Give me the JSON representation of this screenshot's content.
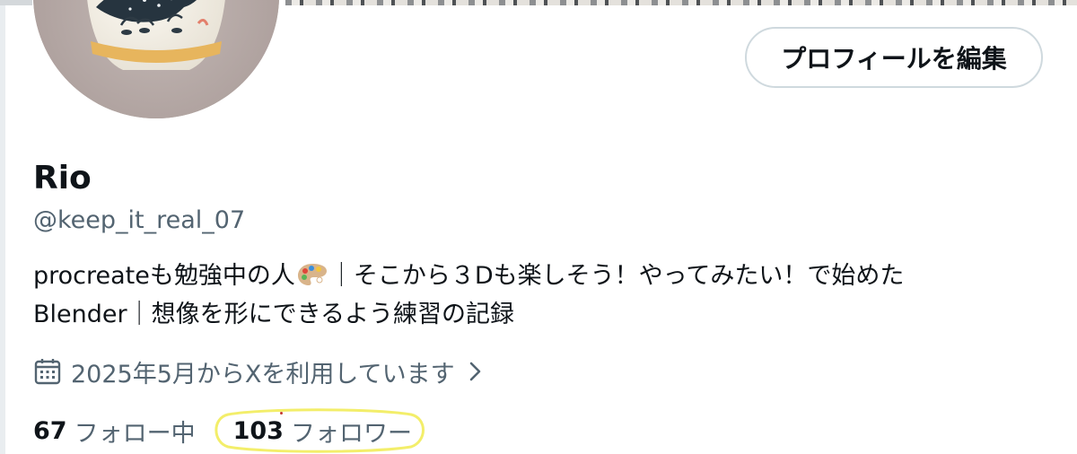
{
  "profile": {
    "edit_button_label": "プロフィールを編集",
    "display_name": "Rio",
    "handle": "@keep_it_real_07",
    "bio": {
      "line1_before": "procreateも勉強中の人",
      "line1_after": "｜そこから３Dも楽しそう！やってみたい！で始めた",
      "line2": "Blender｜想像を形にできるよう練習の記録"
    },
    "joined_text": "2025年5月からXを利用しています",
    "following_count": "67",
    "following_label": "フォロー中",
    "followers_count": "103",
    "followers_label": "フォロワー"
  },
  "icons": {
    "bio_emoji": "artist-palette-icon",
    "joined": "calendar-icon",
    "joined_more": "chevron-right-icon"
  },
  "colors": {
    "primary_text": "#0f1419",
    "secondary_text": "#536471",
    "button_border": "#cfd9de",
    "highlight_annotation": "#f3ee6a"
  }
}
